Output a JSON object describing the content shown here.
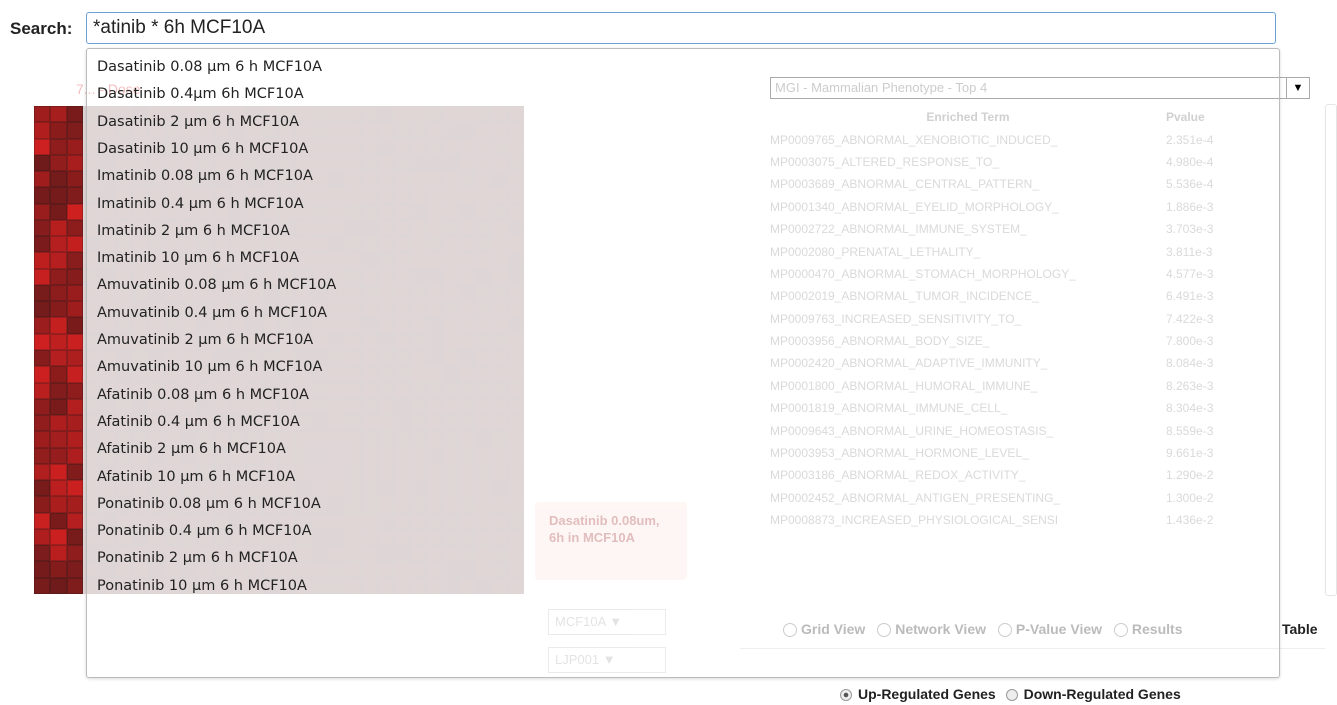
{
  "search": {
    "label": "Search:",
    "value": "*atinib * 6h MCF10A"
  },
  "dropdown": {
    "items": [
      "Dasatinib 0.08 µm 6 h MCF10A",
      "Dasatinib 0.4µm 6h MCF10A",
      "Dasatinib 2 µm 6 h MCF10A",
      "Dasatinib 10 µm 6 h MCF10A",
      "Imatinib 0.08 µm 6 h MCF10A",
      "Imatinib 0.4 µm 6 h MCF10A",
      "Imatinib 2 µm 6 h MCF10A",
      "Imatinib 10 µm 6 h MCF10A",
      "Amuvatinib 0.08 µm 6 h MCF10A",
      "Amuvatinib 0.4 µm 6 h MCF10A",
      "Amuvatinib 2 µm 6 h MCF10A",
      "Amuvatinib 10 µm 6 h MCF10A",
      "Afatinib 0.08 µm 6 h MCF10A",
      "Afatinib 0.4 µm 6 h MCF10A",
      "Afatinib 2 µm 6 h MCF10A",
      "Afatinib 10 µm 6 h MCF10A",
      "Ponatinib 0.08 µm 6 h MCF10A",
      "Ponatinib 0.4 µm 6 h MCF10A",
      "Ponatinib 2 µm 6 h MCF10A",
      "Ponatinib 10 µm 6 h MCF10A"
    ]
  },
  "background": {
    "subtitle": "7... - Dose",
    "term_select": "MGI - Mammalian Phenotype - Top 4",
    "table_headers": {
      "term": "Enriched Term",
      "pvalue": "Pvalue"
    },
    "table_rows": [
      {
        "term": "MP0009765_ABNORMAL_XENOBIOTIC_INDUCED_",
        "pvalue": "2.351e-4"
      },
      {
        "term": "MP0003075_ALTERED_RESPONSE_TO_",
        "pvalue": "4.980e-4"
      },
      {
        "term": "MP0003689_ABNORMAL_CENTRAL_PATTERN_",
        "pvalue": "5.536e-4"
      },
      {
        "term": "MP0001340_ABNORMAL_EYELID_MORPHOLOGY_",
        "pvalue": "1.886e-3"
      },
      {
        "term": "MP0002722_ABNORMAL_IMMUNE_SYSTEM_",
        "pvalue": "3.703e-3"
      },
      {
        "term": "MP0002080_PRENATAL_LETHALITY_",
        "pvalue": "3.811e-3"
      },
      {
        "term": "MP0000470_ABNORMAL_STOMACH_MORPHOLOGY_",
        "pvalue": "4.577e-3"
      },
      {
        "term": "MP0002019_ABNORMAL_TUMOR_INCIDENCE_",
        "pvalue": "6.491e-3"
      },
      {
        "term": "MP0009763_INCREASED_SENSITIVITY_TO_",
        "pvalue": "7.422e-3"
      },
      {
        "term": "MP0003956_ABNORMAL_BODY_SIZE_",
        "pvalue": "7.800e-3"
      },
      {
        "term": "MP0002420_ABNORMAL_ADAPTIVE_IMMUNITY_",
        "pvalue": "8.084e-3"
      },
      {
        "term": "MP0001800_ABNORMAL_HUMORAL_IMMUNE_",
        "pvalue": "8.263e-3"
      },
      {
        "term": "MP0001819_ABNORMAL_IMMUNE_CELL_",
        "pvalue": "8.304e-3"
      },
      {
        "term": "MP0009643_ABNORMAL_URINE_HOMEOSTASIS_",
        "pvalue": "8.559e-3"
      },
      {
        "term": "MP0003953_ABNORMAL_HORMONE_LEVEL_",
        "pvalue": "9.661e-3"
      },
      {
        "term": "MP0003186_ABNORMAL_REDOX_ACTIVITY_",
        "pvalue": "1.290e-2"
      },
      {
        "term": "MP0002452_ABNORMAL_ANTIGEN_PRESENTING_",
        "pvalue": "1.300e-2"
      },
      {
        "term": "MP0008873_INCREASED_PHYSIOLOGICAL_SENSI",
        "pvalue": "1.436e-2"
      }
    ],
    "tooltip": "Dasatinib 0.08um, 6h in MCF10A",
    "cell_select": "MCF10A",
    "batch_select": "LJP001",
    "view_options": [
      "Grid View",
      "Network View",
      "P-Value View",
      "Results"
    ],
    "results_table_suffix": "Table"
  },
  "genes": {
    "up_label": "Up-Regulated Genes",
    "down_label": "Down-Regulated Genes",
    "selected": "up"
  },
  "colors": {
    "input_border": "#6aa0d8",
    "heatmap_dark": "#2a0000",
    "heatmap_red": "#c00000"
  }
}
